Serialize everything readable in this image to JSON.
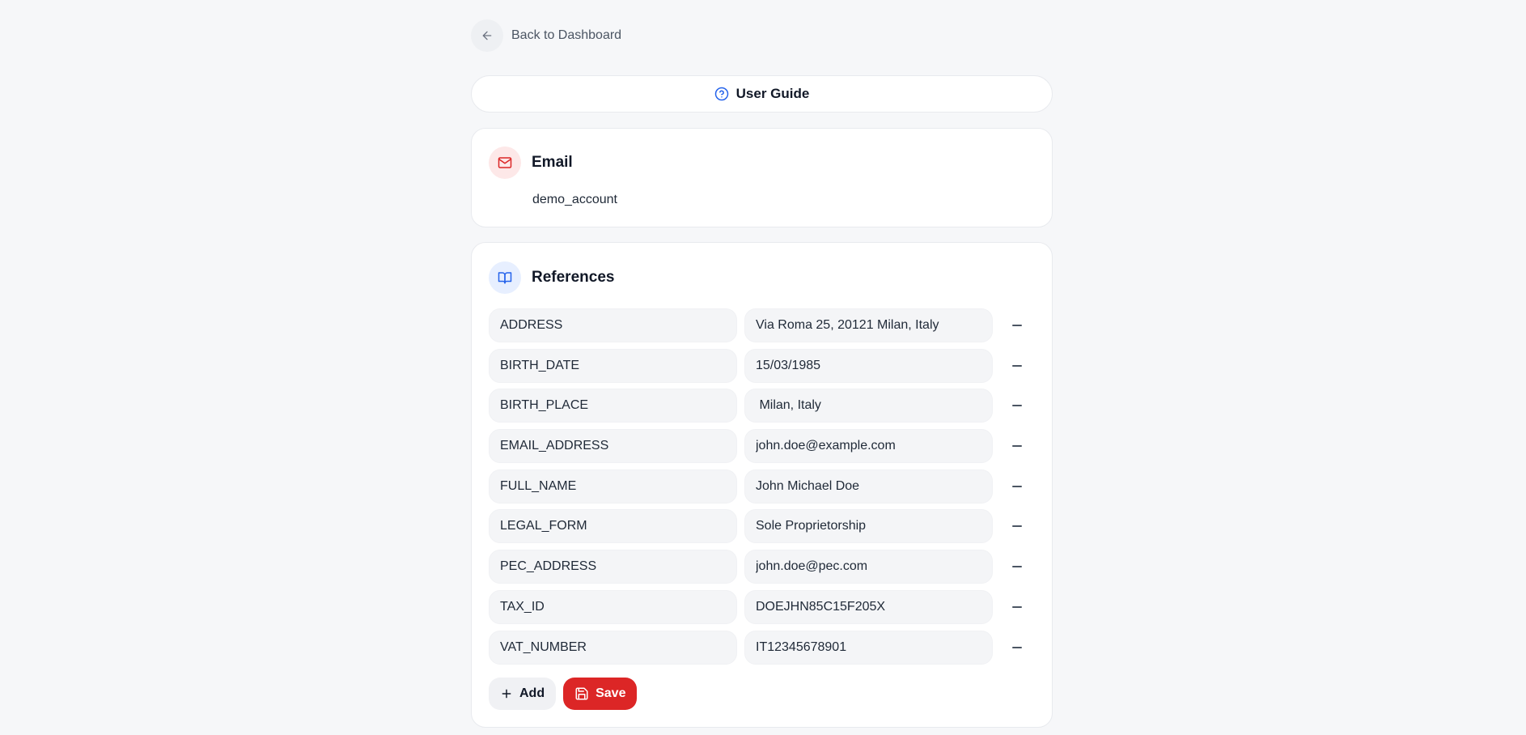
{
  "nav": {
    "back_label": "Back to Dashboard"
  },
  "guide": {
    "label": "User Guide"
  },
  "email_card": {
    "title": "Email",
    "value": "demo_account"
  },
  "references_card": {
    "title": "References",
    "rows": [
      {
        "key": "ADDRESS",
        "value": "Via Roma 25, 20121 Milan, Italy"
      },
      {
        "key": "BIRTH_DATE",
        "value": "15/03/1985"
      },
      {
        "key": "BIRTH_PLACE",
        "value": " Milan, Italy"
      },
      {
        "key": "EMAIL_ADDRESS",
        "value": "john.doe@example.com"
      },
      {
        "key": "FULL_NAME",
        "value": "John Michael Doe"
      },
      {
        "key": "LEGAL_FORM",
        "value": "Sole Proprietorship"
      },
      {
        "key": "PEC_ADDRESS",
        "value": "john.doe@pec.com"
      },
      {
        "key": "TAX_ID",
        "value": "DOEJHN85C15F205X"
      },
      {
        "key": "VAT_NUMBER",
        "value": "IT12345678901"
      }
    ],
    "add_label": "Add",
    "save_label": "Save"
  },
  "colors": {
    "accent_red": "#dc2626",
    "accent_blue": "#2563eb",
    "background": "#f6f7f9"
  },
  "icons": [
    "arrow-left-icon",
    "help-circle-icon",
    "mail-icon",
    "book-open-icon",
    "minus-icon",
    "plus-icon",
    "save-icon"
  ]
}
